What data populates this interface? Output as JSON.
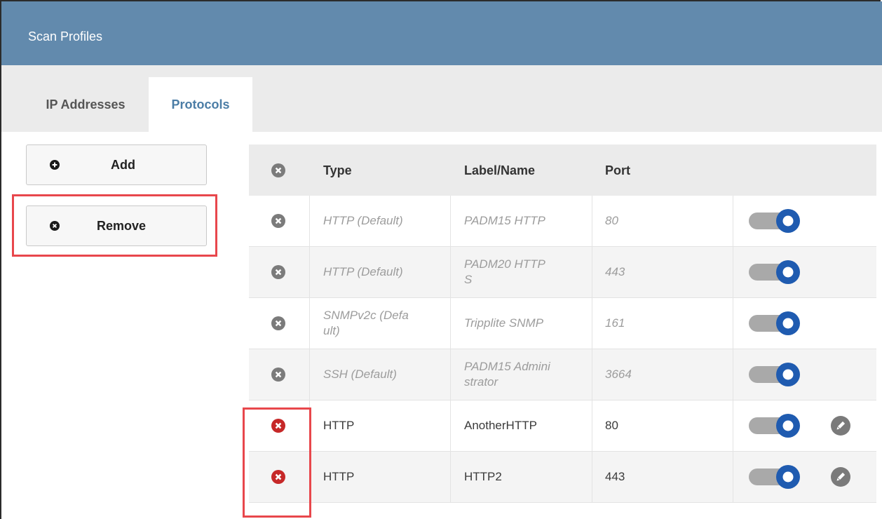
{
  "window": {
    "title": "Scan Profiles"
  },
  "tabs": [
    {
      "label": "IP Addresses",
      "active": false
    },
    {
      "label": "Protocols",
      "active": true
    }
  ],
  "actions": {
    "add_label": "Add",
    "remove_label": "Remove"
  },
  "table": {
    "headers": {
      "type": "Type",
      "label": "Label/Name",
      "port": "Port"
    },
    "rows": [
      {
        "type": "HTTP (Default)",
        "label": "PADM15 HTTP",
        "port": "80",
        "enabled": true,
        "default": true,
        "editable": false
      },
      {
        "type": "HTTP (Default)",
        "label": "PADM20 HTTP\nS",
        "port": "443",
        "enabled": true,
        "default": true,
        "editable": false
      },
      {
        "type": "SNMPv2c (Defa\nult)",
        "label": "Tripplite SNMP",
        "port": "161",
        "enabled": true,
        "default": true,
        "editable": false
      },
      {
        "type": "SSH (Default)",
        "label": "PADM15 Admini\nstrator",
        "port": "3664",
        "enabled": true,
        "default": true,
        "editable": false
      },
      {
        "type": "HTTP",
        "label": "AnotherHTTP",
        "port": "80",
        "enabled": true,
        "default": false,
        "editable": true
      },
      {
        "type": "HTTP",
        "label": "HTTP2",
        "port": "443",
        "enabled": true,
        "default": false,
        "editable": true
      }
    ]
  },
  "icons": {
    "add": "plus-circle-icon",
    "remove": "x-circle-icon",
    "remove_row_default": "x-circle-gray-icon",
    "remove_row_user": "x-circle-red-icon",
    "edit": "pencil-icon",
    "toggle": "toggle-on"
  },
  "colors": {
    "header_bg": "#628aad",
    "tab_active_text": "#4b7da6",
    "highlight_box": "#e8474c",
    "remove_red": "#c62828",
    "toggle_blue": "#1f5bb0",
    "toggle_track": "#a9a9a9"
  }
}
